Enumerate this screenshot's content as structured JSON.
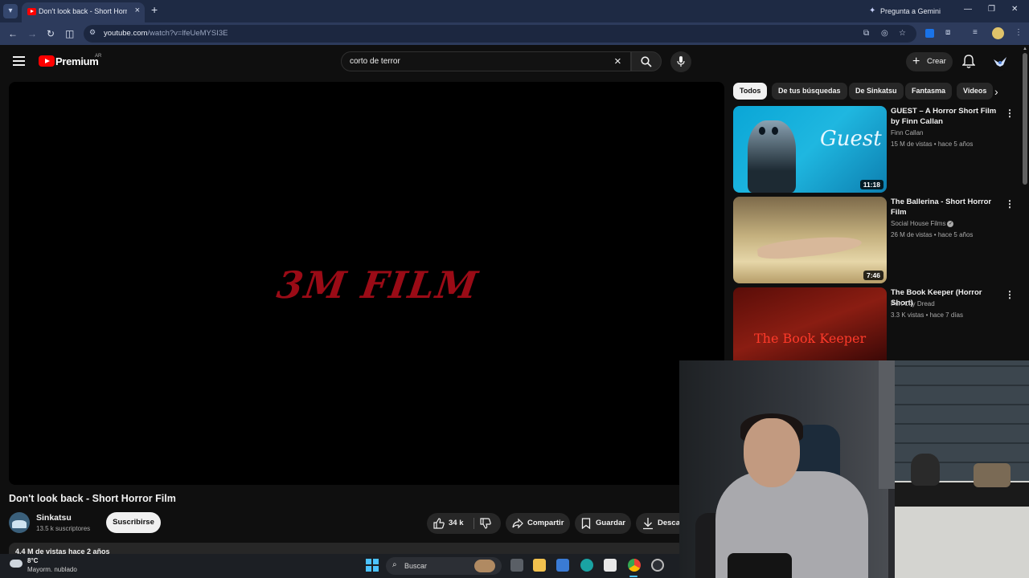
{
  "browser": {
    "tab_title": "Don't look back - Short Horror Film",
    "tab_close": "×",
    "tab_new": "+",
    "gemini_label": "Pregunta a Gemini",
    "url_host": "youtube.com",
    "url_path": "/watch?v=lfeUeMYSI3E",
    "window_controls": [
      "—",
      "❐",
      "✕"
    ]
  },
  "youtube_header": {
    "brand": "Premium",
    "country": "AR",
    "search_value": "corto de terror",
    "create_label": "Crear"
  },
  "player": {
    "video_logo_text": "3M FILM"
  },
  "video": {
    "title": "Don't look back - Short Horror Film",
    "channel_name": "Sinkatsu",
    "channel_subs": "13.5 k suscriptores",
    "subscribe_label": "Suscribirse",
    "like_count": "34 k",
    "share_label": "Compartir",
    "save_label": "Guardar",
    "download_label": "Descargar",
    "meta": "4.4 M de vistas  hace 2 años"
  },
  "chips": [
    "Todos",
    "De tus búsquedas",
    "De Sinkatsu",
    "Fantasma",
    "Videos"
  ],
  "recommendations": [
    {
      "title": "GUEST – A Horror Short Film by Finn Callan",
      "channel": "Finn Callan",
      "meta": "15 M de vistas • hace 5 años",
      "duration": "11:18",
      "thumb_text": "Guest",
      "verified": false
    },
    {
      "title": "The Ballerina - Short Horror Film",
      "channel": "Social House Films",
      "meta": "26 M de vistas • hace 5 años",
      "duration": "7:46",
      "thumb_text": "",
      "verified": true
    },
    {
      "title": "The Book Keeper (Horror Short)",
      "channel": "Port City Dread",
      "meta": "3.3 K vistas • hace 7 días",
      "duration": "",
      "thumb_text": "The Book Keeper",
      "verified": false
    }
  ],
  "taskbar": {
    "weather_temp": "8°C",
    "weather_desc": "Mayorm. nublado",
    "search_label": "Buscar"
  },
  "colors": {
    "youtube_red": "#ff0000",
    "background": "#0f0f0f",
    "chrome_frame": "#1e2a44",
    "accent_blue": "#4cc2ff"
  }
}
